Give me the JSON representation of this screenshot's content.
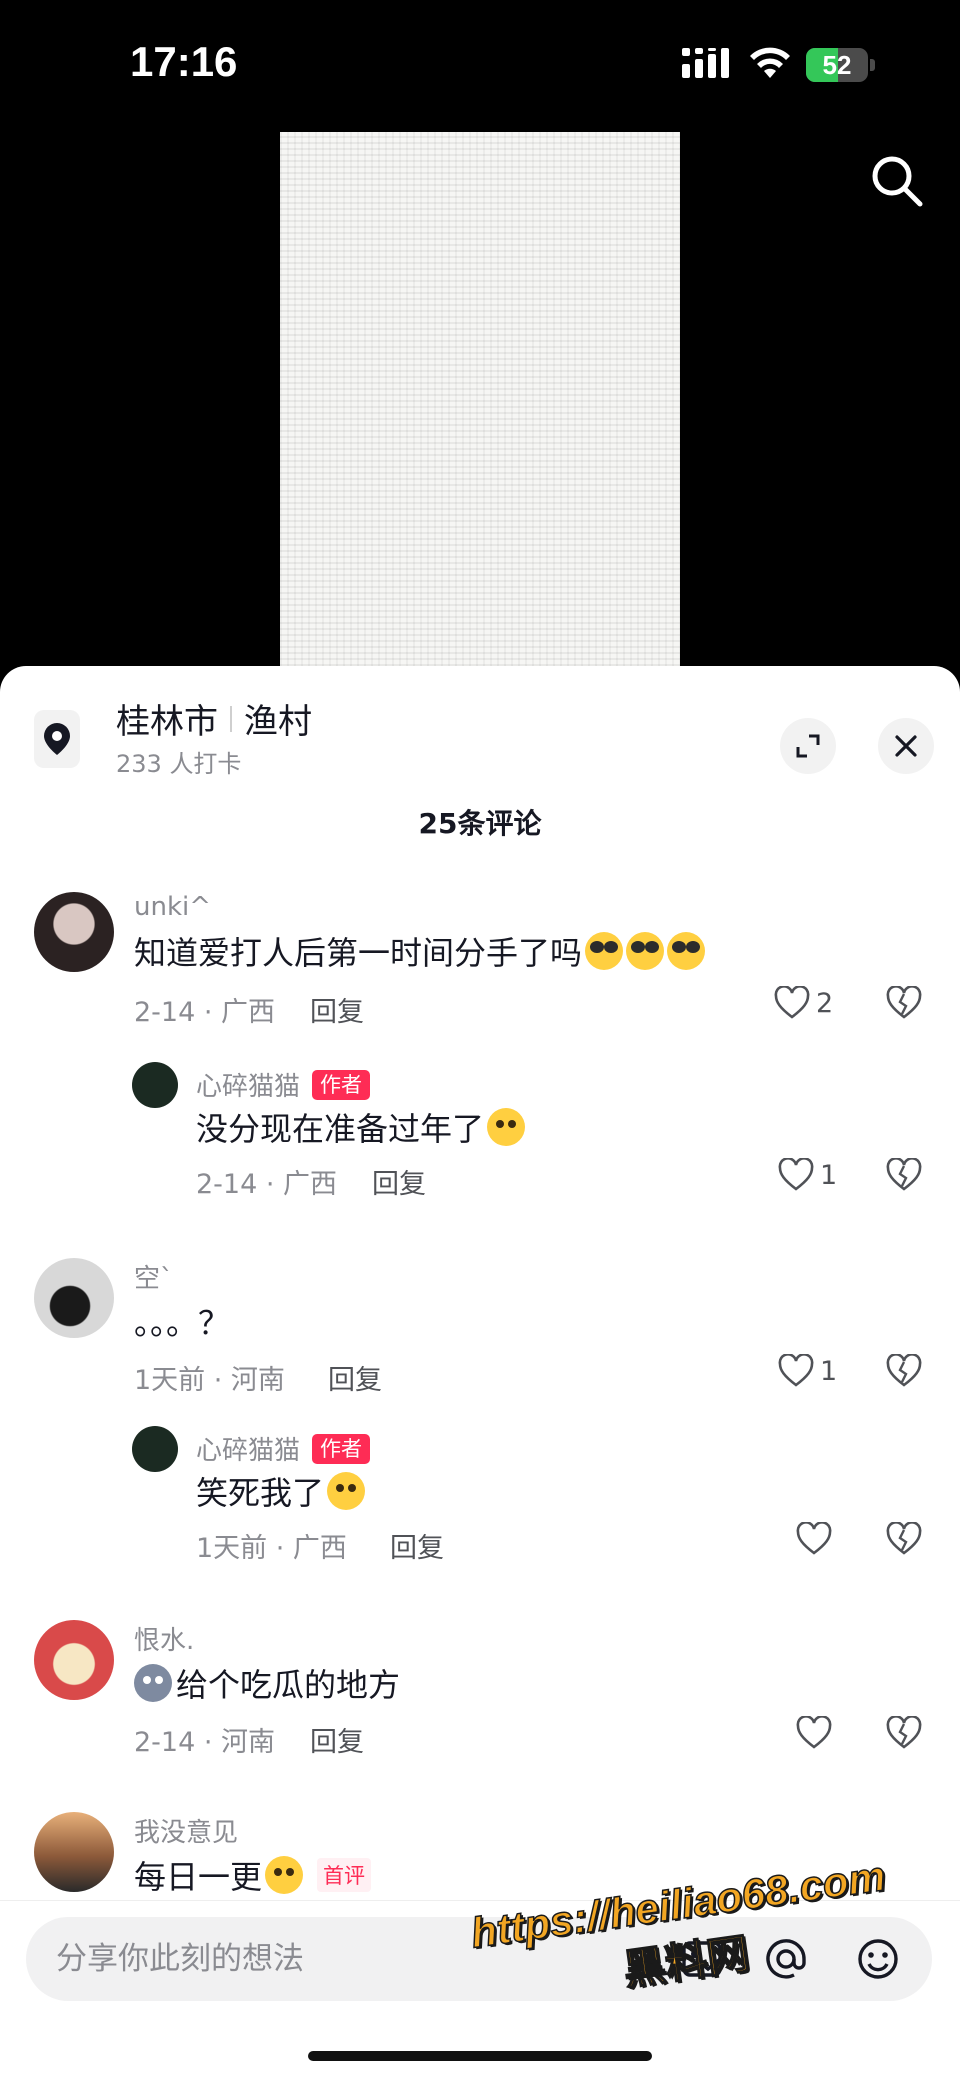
{
  "status_bar": {
    "time": "17:16",
    "battery": "52",
    "battery_level": 0.52
  },
  "location": {
    "city": "桂林市",
    "place": "渔村",
    "checkins": "233 人打卡"
  },
  "comments_count": "25条评论",
  "comments": [
    {
      "user": "unki^",
      "text": "知道爱打人后第一时间分手了吗",
      "date": "2-14 · 广西",
      "reply": "回复",
      "likes": "2"
    },
    {
      "user": "心碎猫猫",
      "badge": "作者",
      "text": "没分现在准备过年了",
      "date": "2-14 · 广西",
      "reply": "回复",
      "likes": "1"
    },
    {
      "user": "空`",
      "text": "。。。？",
      "date": "1天前 · 河南",
      "reply": "回复",
      "likes": "1"
    },
    {
      "user": "心碎猫猫",
      "badge": "作者",
      "text": "笑死我了",
      "date": "1天前 · 广西",
      "reply": "回复",
      "likes": ""
    },
    {
      "user": "恨水.",
      "text": "给个吃瓜的地方",
      "date": "2-14 · 河南",
      "reply": "回复",
      "likes": ""
    },
    {
      "user": "我没意见",
      "text": "每日一更",
      "badge": "首评"
    }
  ],
  "input": {
    "placeholder": "分享你此刻的想法"
  },
  "watermark": {
    "url": "https://heiliao68.com",
    "name": "黑料网"
  },
  "icons": {
    "search": "search-icon",
    "location": "location-pin-icon",
    "expand": "expand-icon",
    "close": "close-icon",
    "like": "heart-icon",
    "dislike": "broken-heart-icon",
    "image": "image-icon",
    "at": "at-icon",
    "emoji": "emoji-icon"
  },
  "colors": {
    "accent": "#fe2c55",
    "battery": "#34c759",
    "watermark": "#f2a623"
  }
}
